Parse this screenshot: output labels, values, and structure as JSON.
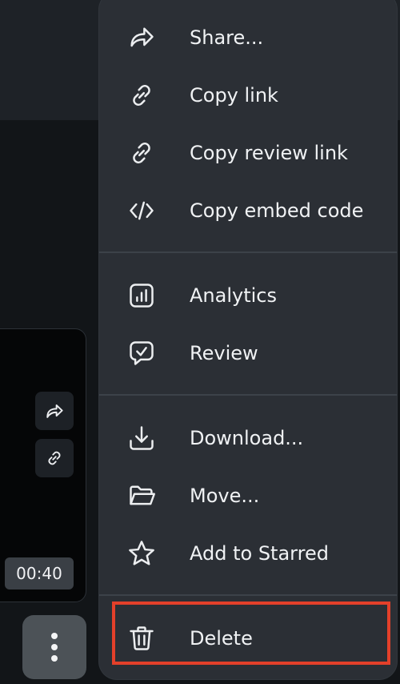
{
  "background_card": {
    "duration": "00:40"
  },
  "menu": {
    "items": [
      {
        "id": "share",
        "label": "Share...",
        "icon": "share-icon"
      },
      {
        "id": "copy-link",
        "label": "Copy link",
        "icon": "link-icon"
      },
      {
        "id": "copy-review-link",
        "label": "Copy review link",
        "icon": "link-icon"
      },
      {
        "id": "copy-embed-code",
        "label": "Copy embed code",
        "icon": "code-icon"
      },
      {
        "id": "analytics",
        "label": "Analytics",
        "icon": "analytics-icon"
      },
      {
        "id": "review",
        "label": "Review",
        "icon": "review-icon"
      },
      {
        "id": "download",
        "label": "Download...",
        "icon": "download-icon"
      },
      {
        "id": "move",
        "label": "Move...",
        "icon": "folder-icon"
      },
      {
        "id": "add-to-starred",
        "label": "Add to Starred",
        "icon": "star-icon"
      },
      {
        "id": "delete",
        "label": "Delete",
        "icon": "trash-icon",
        "highlighted": true
      }
    ]
  },
  "colors": {
    "menu_bg": "#2b2f35",
    "highlight": "#e3402a",
    "text": "#f0f2f4"
  }
}
